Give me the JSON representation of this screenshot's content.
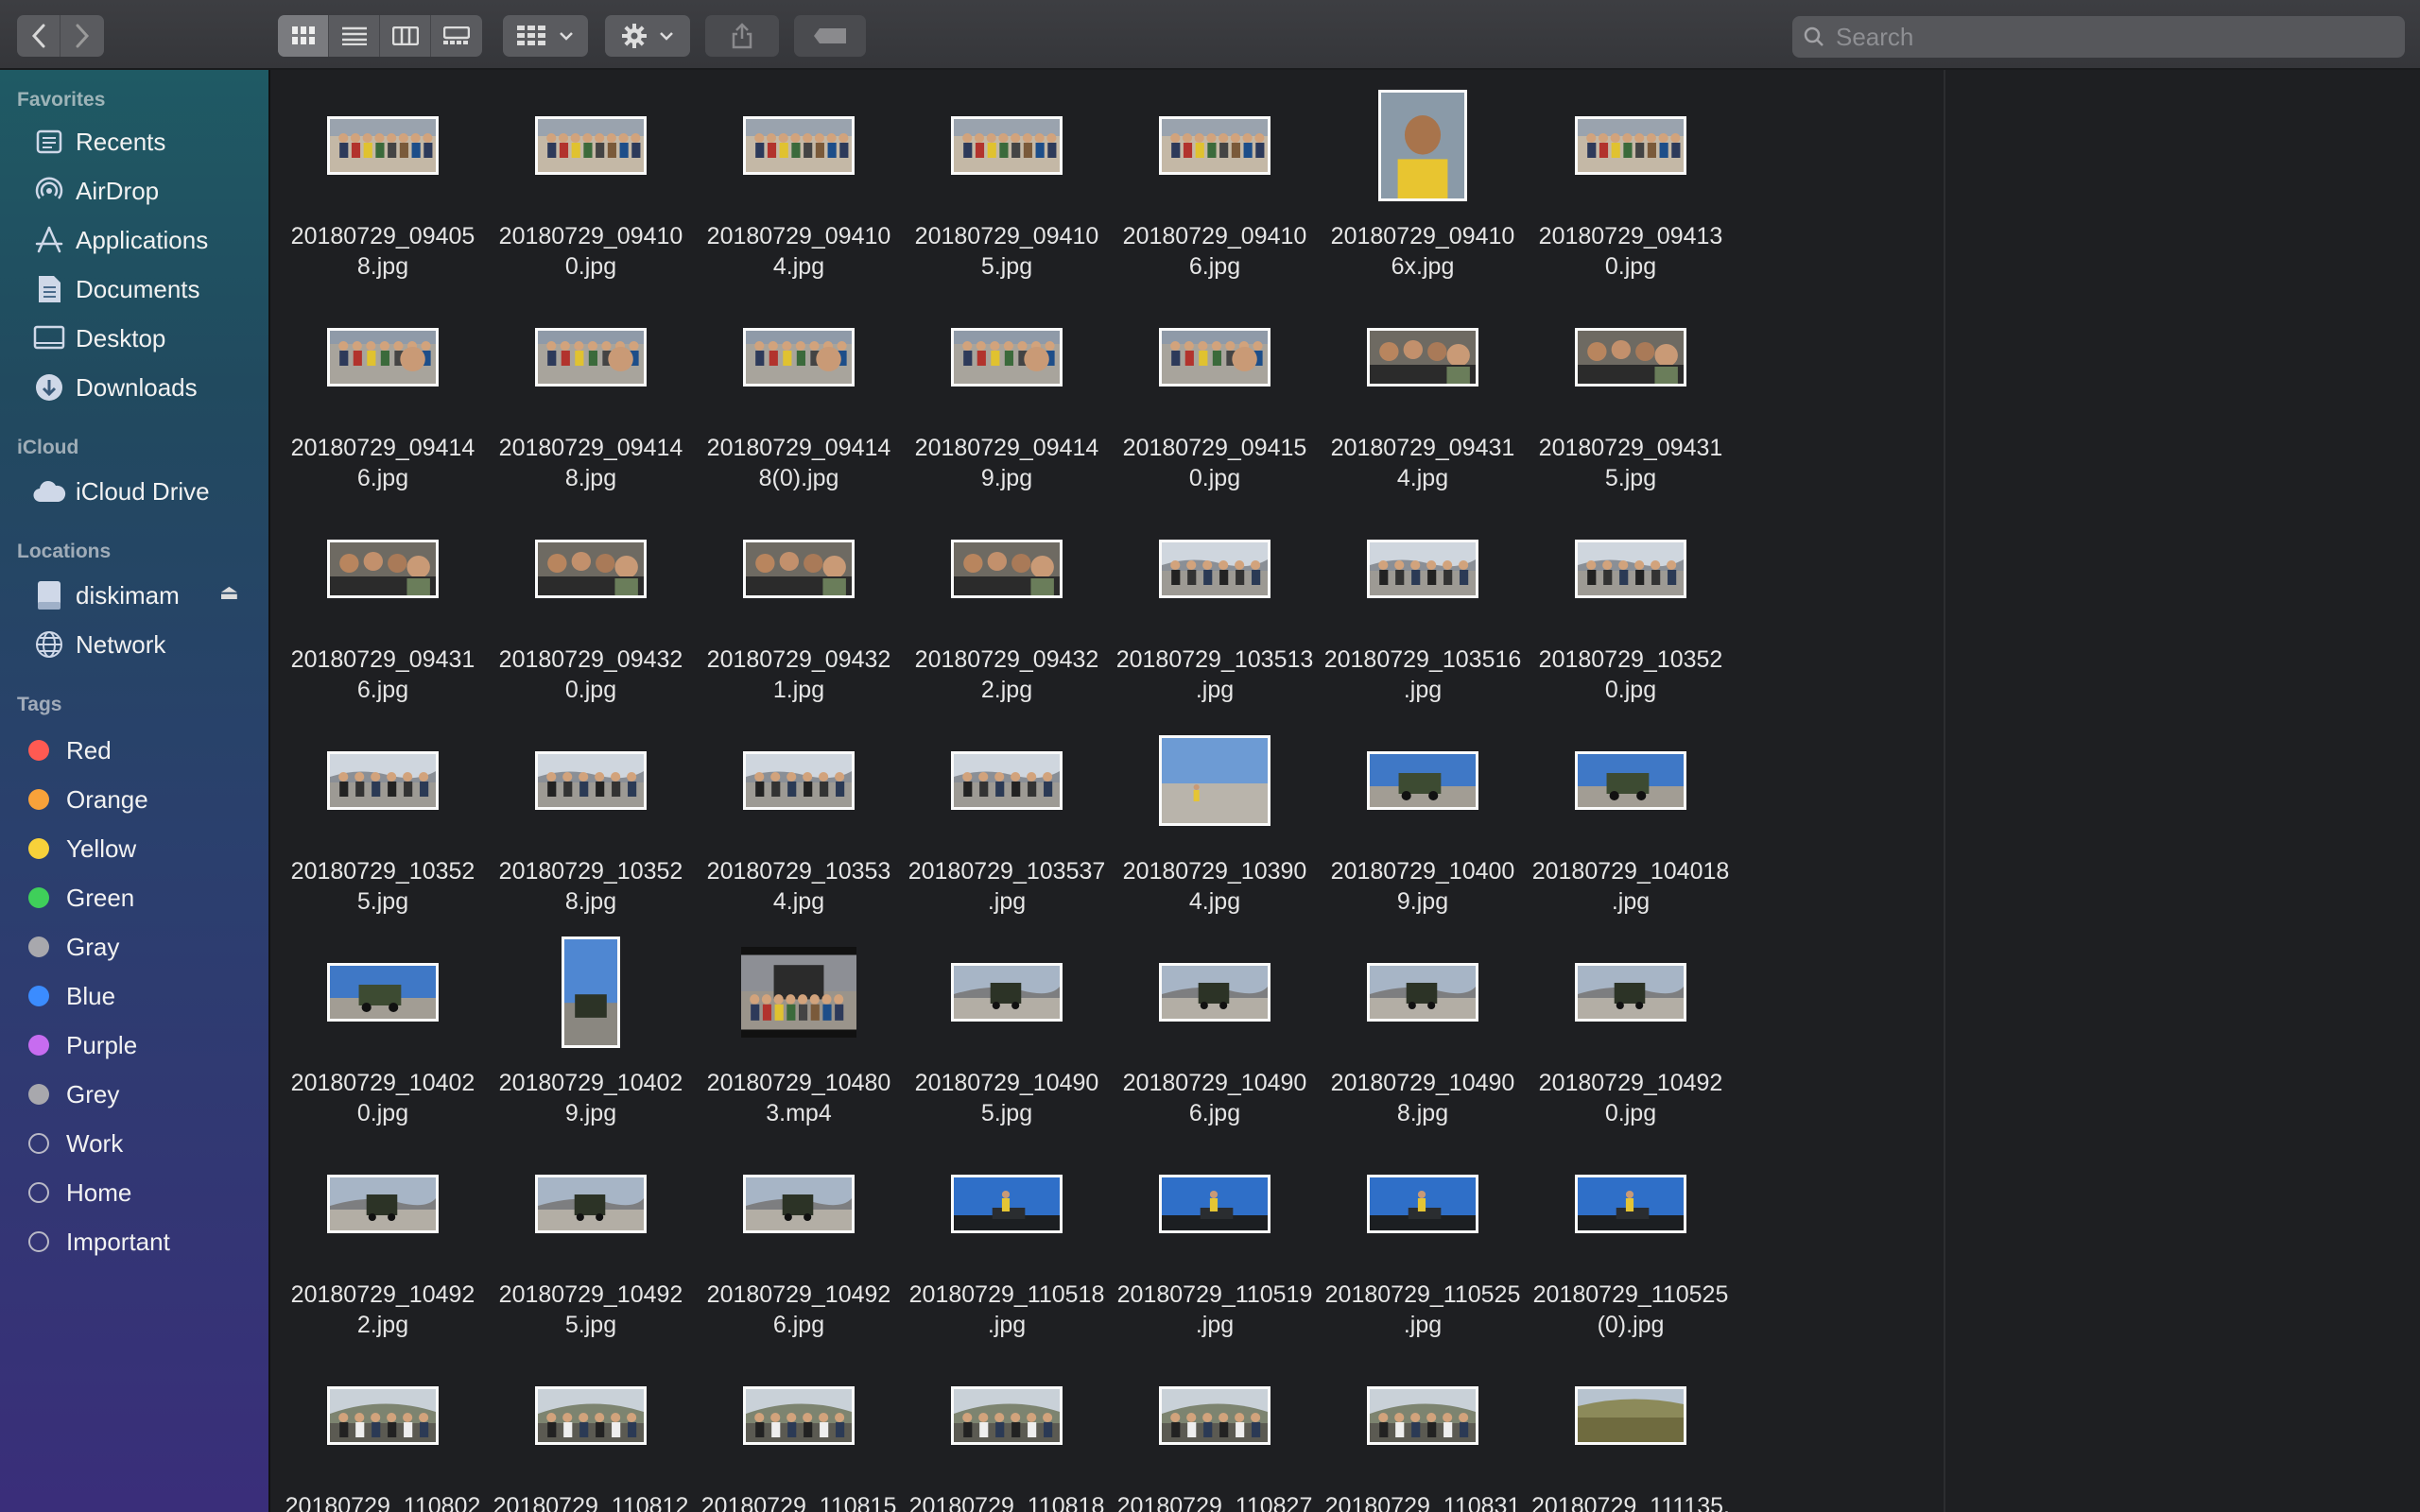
{
  "search": {
    "placeholder": "Search"
  },
  "sidebar": {
    "favorites_title": "Favorites",
    "favorites": [
      {
        "label": "Recents",
        "icon": "clock-icon"
      },
      {
        "label": "AirDrop",
        "icon": "airdrop-icon"
      },
      {
        "label": "Applications",
        "icon": "applications-icon"
      },
      {
        "label": "Documents",
        "icon": "document-icon"
      },
      {
        "label": "Desktop",
        "icon": "desktop-icon"
      },
      {
        "label": "Downloads",
        "icon": "download-icon"
      }
    ],
    "icloud_title": "iCloud",
    "icloud": [
      {
        "label": "iCloud Drive",
        "icon": "cloud-icon"
      }
    ],
    "locations_title": "Locations",
    "locations": [
      {
        "label": "diskimam",
        "icon": "disk-icon"
      },
      {
        "label": "Network",
        "icon": "network-icon"
      }
    ],
    "tags_title": "Tags",
    "tags": [
      {
        "label": "Red",
        "color": "#ff5a52"
      },
      {
        "label": "Orange",
        "color": "#f8a23a"
      },
      {
        "label": "Yellow",
        "color": "#f7d13a"
      },
      {
        "label": "Green",
        "color": "#3fcf5a"
      },
      {
        "label": "Gray",
        "color": "#a8a8ad"
      },
      {
        "label": "Blue",
        "color": "#3b8cff"
      },
      {
        "label": "Purple",
        "color": "#c76cf0"
      },
      {
        "label": "Grey",
        "color": "#a8a8ad"
      },
      {
        "label": "Work",
        "color": ""
      },
      {
        "label": "Home",
        "color": ""
      },
      {
        "label": "Important",
        "color": ""
      }
    ]
  },
  "files": [
    {
      "name": "20180729_09405\n8.jpg",
      "kind": "group"
    },
    {
      "name": "20180729_09410\n0.jpg",
      "kind": "group"
    },
    {
      "name": "20180729_09410\n4.jpg",
      "kind": "group"
    },
    {
      "name": "20180729_09410\n5.jpg",
      "kind": "group"
    },
    {
      "name": "20180729_09410\n6.jpg",
      "kind": "group"
    },
    {
      "name": "20180729_09410\n6x.jpg",
      "kind": "portrait"
    },
    {
      "name": "20180729_09413\n0.jpg",
      "kind": "group"
    },
    {
      "name": "20180729_09414\n6.jpg",
      "kind": "selfie"
    },
    {
      "name": "20180729_09414\n8.jpg",
      "kind": "selfie"
    },
    {
      "name": "20180729_09414\n8(0).jpg",
      "kind": "selfie"
    },
    {
      "name": "20180729_09414\n9.jpg",
      "kind": "selfie"
    },
    {
      "name": "20180729_09415\n0.jpg",
      "kind": "selfie"
    },
    {
      "name": "20180729_09431\n4.jpg",
      "kind": "closeup"
    },
    {
      "name": "20180729_09431\n5.jpg",
      "kind": "closeup"
    },
    {
      "name": "20180729_09431\n6.jpg",
      "kind": "closeup"
    },
    {
      "name": "20180729_09432\n0.jpg",
      "kind": "closeup"
    },
    {
      "name": "20180729_09432\n1.jpg",
      "kind": "closeup"
    },
    {
      "name": "20180729_09432\n2.jpg",
      "kind": "closeup"
    },
    {
      "name": "20180729_103513\n.jpg",
      "kind": "desert"
    },
    {
      "name": "20180729_103516\n.jpg",
      "kind": "desert"
    },
    {
      "name": "20180729_10352\n0.jpg",
      "kind": "desert"
    },
    {
      "name": "20180729_10352\n5.jpg",
      "kind": "desert"
    },
    {
      "name": "20180729_10352\n8.jpg",
      "kind": "desert"
    },
    {
      "name": "20180729_10353\n4.jpg",
      "kind": "desert"
    },
    {
      "name": "20180729_103537\n.jpg",
      "kind": "desert"
    },
    {
      "name": "20180729_10390\n4.jpg",
      "kind": "sky-large"
    },
    {
      "name": "20180729_10400\n9.jpg",
      "kind": "jeep"
    },
    {
      "name": "20180729_104018\n.jpg",
      "kind": "jeep"
    },
    {
      "name": "20180729_10402\n0.jpg",
      "kind": "jeep"
    },
    {
      "name": "20180729_10402\n9.jpg",
      "kind": "tall"
    },
    {
      "name": "20180729_10480\n3.mp4",
      "kind": "video"
    },
    {
      "name": "20180729_10490\n5.jpg",
      "kind": "jeep2"
    },
    {
      "name": "20180729_10490\n6.jpg",
      "kind": "jeep2"
    },
    {
      "name": "20180729_10490\n8.jpg",
      "kind": "jeep2"
    },
    {
      "name": "20180729_10492\n0.jpg",
      "kind": "jeep2"
    },
    {
      "name": "20180729_10492\n2.jpg",
      "kind": "jeep2"
    },
    {
      "name": "20180729_10492\n5.jpg",
      "kind": "jeep2"
    },
    {
      "name": "20180729_10492\n6.jpg",
      "kind": "jeep2"
    },
    {
      "name": "20180729_110518\n.jpg",
      "kind": "bluesky"
    },
    {
      "name": "20180729_110519\n.jpg",
      "kind": "bluesky"
    },
    {
      "name": "20180729_110525\n.jpg",
      "kind": "bluesky"
    },
    {
      "name": "20180729_110525\n(0).jpg",
      "kind": "bluesky"
    },
    {
      "name": "20180729_110802",
      "kind": "hill"
    },
    {
      "name": "20180729_110812",
      "kind": "hill"
    },
    {
      "name": "20180729_110815",
      "kind": "hill"
    },
    {
      "name": "20180729_110818",
      "kind": "hill"
    },
    {
      "name": "20180729_110827",
      "kind": "hill"
    },
    {
      "name": "20180729_110831",
      "kind": "hill"
    },
    {
      "name": "20180729_111135.",
      "kind": "savanna"
    }
  ]
}
